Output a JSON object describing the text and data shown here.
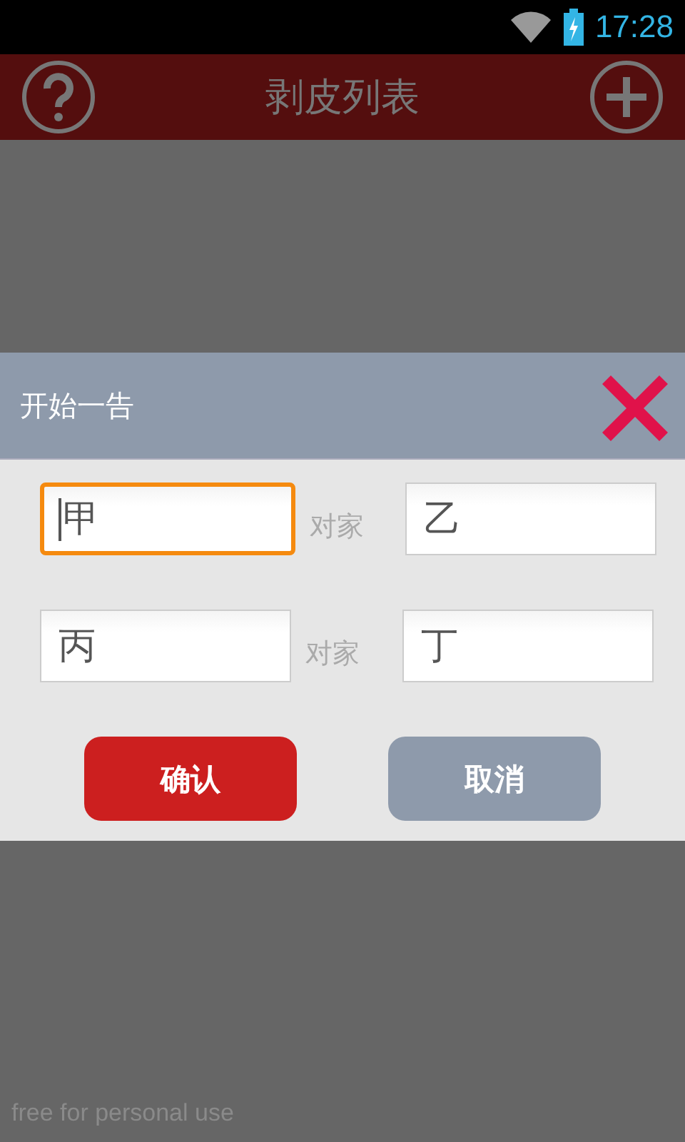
{
  "status_bar": {
    "time": "17:28"
  },
  "app_bar": {
    "title": "剥皮列表"
  },
  "dialog": {
    "title": "开始一告",
    "rows": [
      {
        "left": {
          "value": "甲",
          "focused": true
        },
        "separator": "对家",
        "right": {
          "value": "乙",
          "focused": false
        }
      },
      {
        "left": {
          "value": "丙",
          "focused": false
        },
        "separator": "对家",
        "right": {
          "value": "丁",
          "focused": false
        }
      }
    ],
    "buttons": [
      {
        "label": "确认",
        "kind": "primary"
      },
      {
        "label": "取消",
        "kind": "secondary"
      }
    ]
  },
  "footer_note": "free for personal use"
}
